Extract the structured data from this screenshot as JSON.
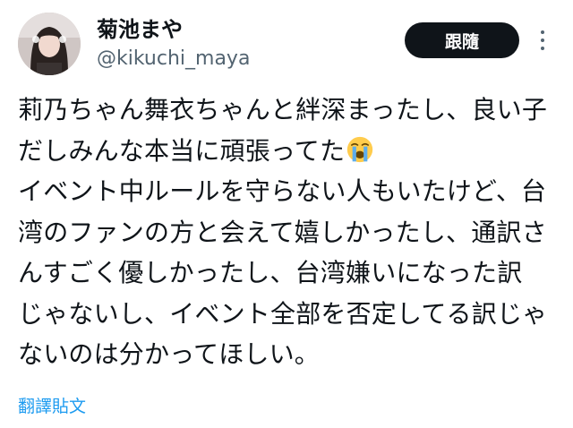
{
  "author": {
    "display_name": "菊池まや",
    "handle": "@kikuchi_maya"
  },
  "actions": {
    "follow_label": "跟隨",
    "more_icon": "more-options-icon"
  },
  "tweet": {
    "lines": [
      "莉乃ちゃん舞衣ちゃんと絆深まったし、良い子",
      "だしみんな本当に頑張ってた",
      "イベント中ルールを守らない人もいたけど、台",
      "湾のファンの方と会えて嬉しかったし、通訳さ",
      "んすごく優しかったし、台湾嫌いになった訳",
      "じゃないし、イベント全部を否定してる訳じゃ",
      "ないのは分かってほしい。"
    ],
    "emoji": "loudly-crying-face-emoji"
  },
  "translate_label": "翻譯貼文",
  "colors": {
    "text": "#0f1419",
    "secondary": "#536471",
    "link": "#1d9bf0",
    "button_bg": "#0f1419",
    "button_text": "#ffffff",
    "background": "#ffffff"
  }
}
